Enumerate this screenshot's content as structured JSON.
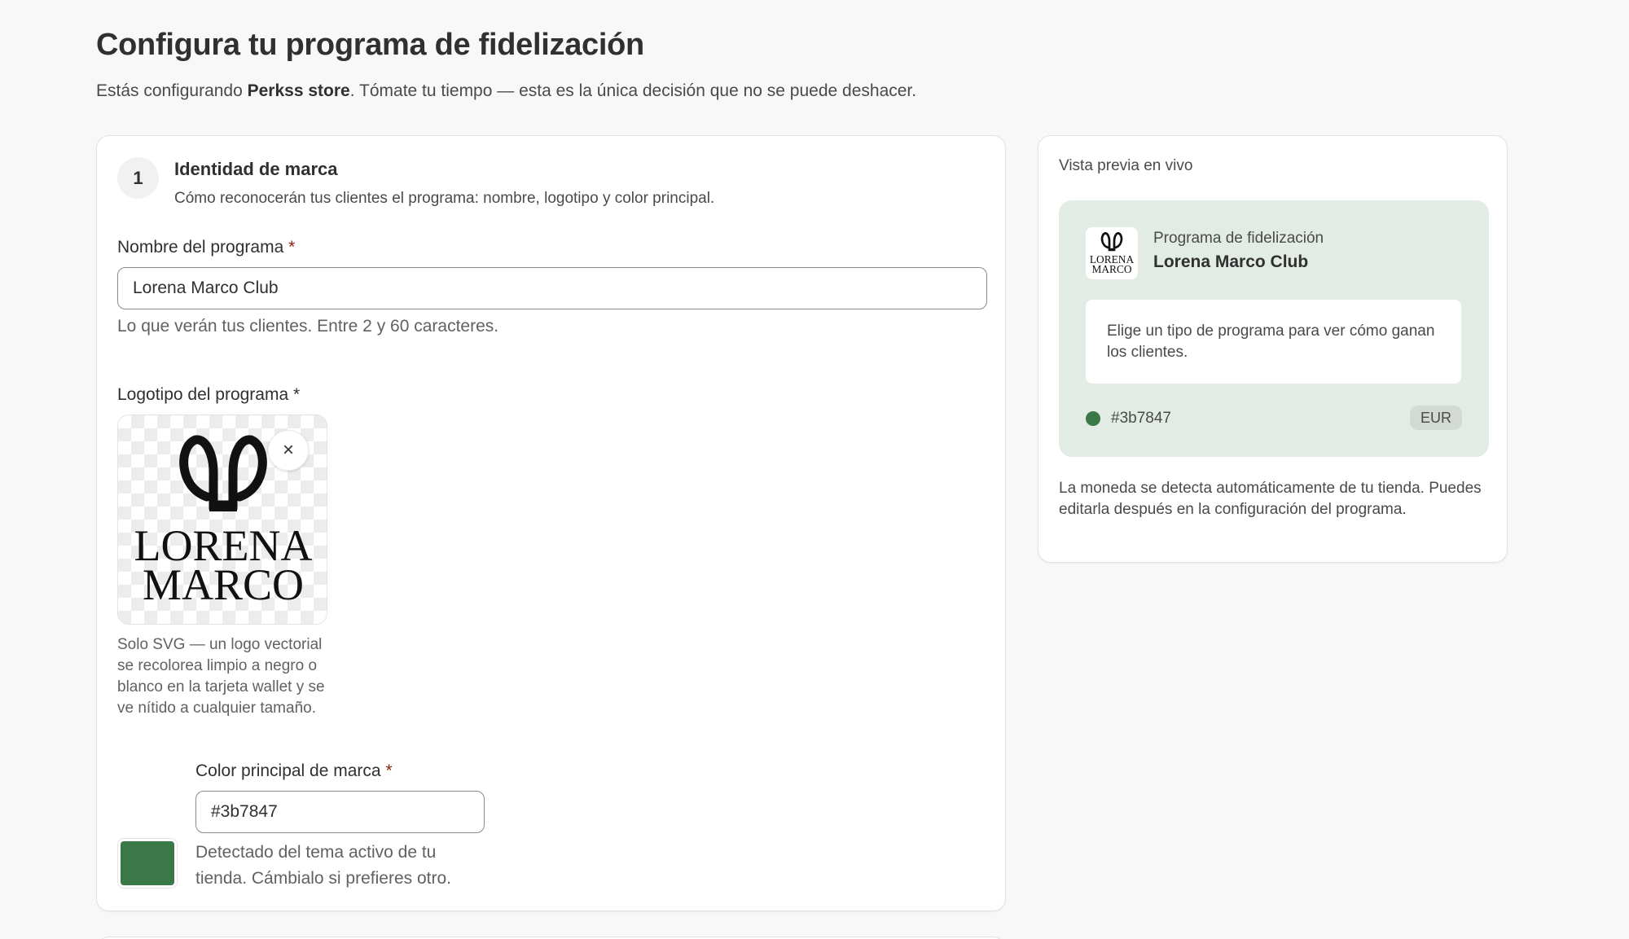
{
  "page": {
    "title": "Configura tu programa de fidelización",
    "subtitle_before": "Estás configurando ",
    "store_name": "Perkss store",
    "subtitle_after": ". Tómate tu tiempo — esta es la única decisión que no se puede deshacer."
  },
  "brand_section": {
    "step_number": "1",
    "title": "Identidad de marca",
    "description": "Cómo reconocerán tus clientes el programa: nombre, logotipo y color principal.",
    "name_field": {
      "label": "Nombre del programa",
      "required_mark": "*",
      "value": "Lorena Marco Club",
      "help": "Lo que verán tus clientes. Entre 2 y 60 caracteres."
    },
    "logo_field": {
      "label": "Logotipo del programa *",
      "remove_symbol": "×",
      "logo_line1": "LORENA",
      "logo_line2": "MARCO",
      "help": "Solo SVG — un logo vectorial se recolorea limpio a negro o blanco en la tarjeta wallet y se ve nítido a cualquier tamaño."
    },
    "color_field": {
      "label": "Color principal de marca",
      "required_mark": "*",
      "value": "#3b7847",
      "help": "Detectado del tema activo de tu tienda. Cámbialo si prefieres otro."
    }
  },
  "preview": {
    "label": "Vista previa en vivo",
    "program_label": "Programa de fidelización",
    "program_name": "Lorena Marco Club",
    "message": "Elige un tipo de programa para ver cómo ganan los clientes.",
    "color_hex": "#3b7847",
    "currency": "EUR",
    "note": "La moneda se detecta automáticamente de tu tienda. Puedes editarla después en la configuración del programa."
  },
  "colors": {
    "brand": "#3b7847",
    "preview_panel_bg": "#e2ebe4",
    "logo_ink": "#111111"
  }
}
